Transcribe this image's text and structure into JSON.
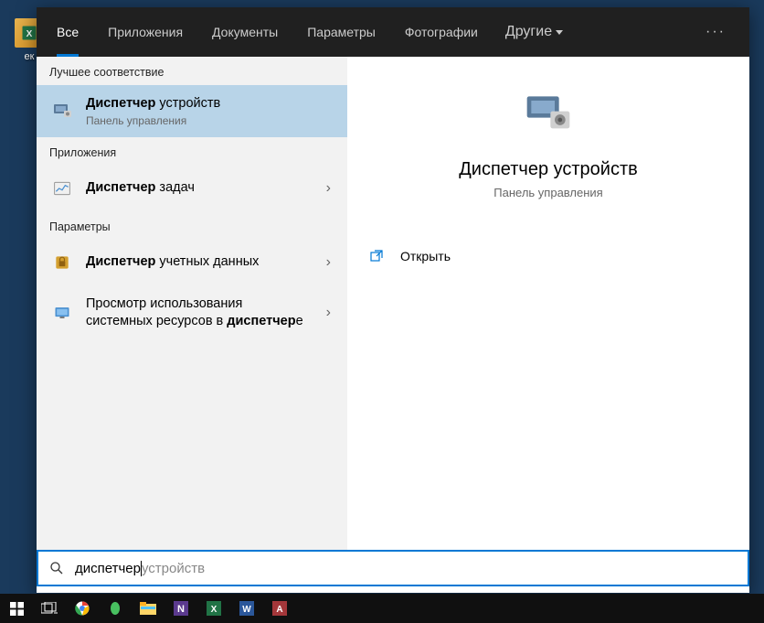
{
  "desktop": {
    "icon_label": "ек"
  },
  "tabs": {
    "all": "Все",
    "apps": "Приложения",
    "docs": "Документы",
    "settings": "Параметры",
    "photos": "Фотографии",
    "more": "Другие"
  },
  "sections": {
    "best_match": "Лучшее соответствие",
    "apps": "Приложения",
    "settings": "Параметры"
  },
  "results": {
    "device_manager": {
      "title_bold": "Диспетчер",
      "title_rest": " устройств",
      "subtitle": "Панель управления"
    },
    "task_manager": {
      "title_bold": "Диспетчер",
      "title_rest": " задач"
    },
    "credential_manager": {
      "title_bold": "Диспетчер",
      "title_rest": " учетных данных"
    },
    "resource_usage": {
      "line1": "Просмотр использования",
      "line2_pre": "системных ресурсов в ",
      "line2_bold": "диспетчер",
      "line2_post": "е"
    }
  },
  "preview": {
    "title": "Диспетчер устройств",
    "subtitle": "Панель управления",
    "open": "Открыть"
  },
  "search": {
    "typed": "диспетчер",
    "suggestion": " устройств"
  }
}
